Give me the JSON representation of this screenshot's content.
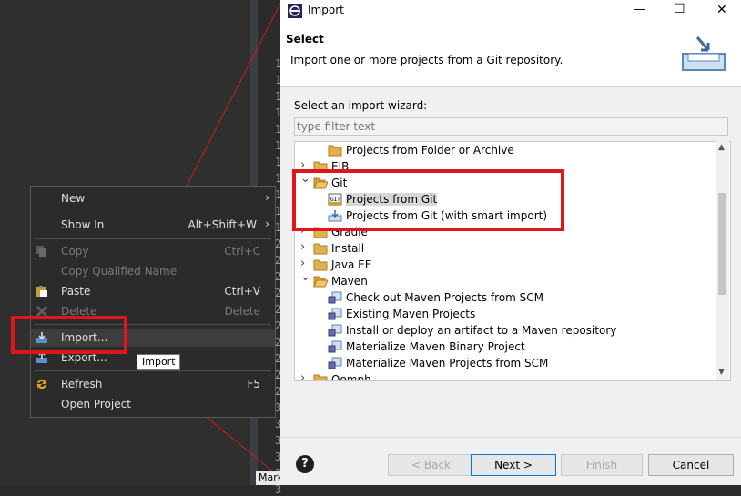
{
  "editor": {
    "line_numbers": [
      "1",
      "1",
      "1",
      "1",
      "1",
      "1",
      "1",
      "1",
      "1",
      "1",
      "1",
      "2",
      "2",
      "2",
      "2",
      "2",
      "2",
      "2",
      "2",
      "2",
      "2",
      "3",
      "3",
      "3",
      "3",
      "3",
      "3"
    ],
    "mark_tab": "Mark"
  },
  "context_menu": {
    "items": [
      {
        "label": "New",
        "accel": "",
        "submenu": true,
        "disabled": false
      },
      {
        "label": "Show In",
        "accel": "Alt+Shift+W",
        "submenu": true,
        "disabled": false
      },
      {
        "label": "Copy",
        "accel": "Ctrl+C",
        "disabled": true
      },
      {
        "label": "Copy Qualified Name",
        "accel": "",
        "disabled": true
      },
      {
        "label": "Paste",
        "accel": "Ctrl+V",
        "disabled": false
      },
      {
        "label": "Delete",
        "accel": "Delete",
        "disabled": true
      },
      {
        "label": "Import...",
        "accel": "",
        "disabled": false
      },
      {
        "label": "Export...",
        "accel": "",
        "disabled": false
      },
      {
        "label": "Refresh",
        "accel": "F5",
        "disabled": false
      },
      {
        "label": "Open Project",
        "accel": "",
        "disabled": false
      }
    ],
    "tooltip": "Import"
  },
  "dialog": {
    "title": "Import",
    "banner_title": "Select",
    "banner_desc": "Import one or more projects from a Git repository.",
    "wizard_label": "Select an import wizard:",
    "filter_placeholder": "type filter text",
    "tree": [
      {
        "label": "Projects from Folder or Archive",
        "level": 1,
        "twisty": "",
        "icon": "folder-import-icon"
      },
      {
        "label": "EJB",
        "level": 0,
        "twisty": ">",
        "icon": "folder-icon"
      },
      {
        "label": "Git",
        "level": 0,
        "twisty": "v",
        "icon": "folder-open-icon"
      },
      {
        "label": "Projects from Git",
        "level": 1,
        "twisty": "",
        "icon": "git-icon",
        "highlight": true
      },
      {
        "label": "Projects from Git (with smart import)",
        "level": 1,
        "twisty": "",
        "icon": "smart-import-icon"
      },
      {
        "label": "Gradle",
        "level": 0,
        "twisty": ">",
        "icon": "folder-icon"
      },
      {
        "label": "Install",
        "level": 0,
        "twisty": ">",
        "icon": "folder-icon"
      },
      {
        "label": "Java EE",
        "level": 0,
        "twisty": ">",
        "icon": "folder-icon"
      },
      {
        "label": "Maven",
        "level": 0,
        "twisty": "v",
        "icon": "folder-open-icon"
      },
      {
        "label": "Check out Maven Projects from SCM",
        "level": 1,
        "twisty": "",
        "icon": "maven-icon"
      },
      {
        "label": "Existing Maven Projects",
        "level": 1,
        "twisty": "",
        "icon": "maven-icon"
      },
      {
        "label": "Install or deploy an artifact to a Maven repository",
        "level": 1,
        "twisty": "",
        "icon": "maven-icon"
      },
      {
        "label": "Materialize Maven Binary Project",
        "level": 1,
        "twisty": "",
        "icon": "maven-icon"
      },
      {
        "label": "Materialize Maven Projects from SCM",
        "level": 1,
        "twisty": "",
        "icon": "maven-icon"
      },
      {
        "label": "Oomph",
        "level": 0,
        "twisty": ">",
        "icon": "folder-icon"
      }
    ],
    "buttons": {
      "back": "< Back",
      "next": "Next >",
      "finish": "Finish",
      "cancel": "Cancel"
    },
    "help": "?"
  },
  "window_controls": {
    "minimize": "—",
    "maximize": "☐",
    "close": "✕"
  }
}
